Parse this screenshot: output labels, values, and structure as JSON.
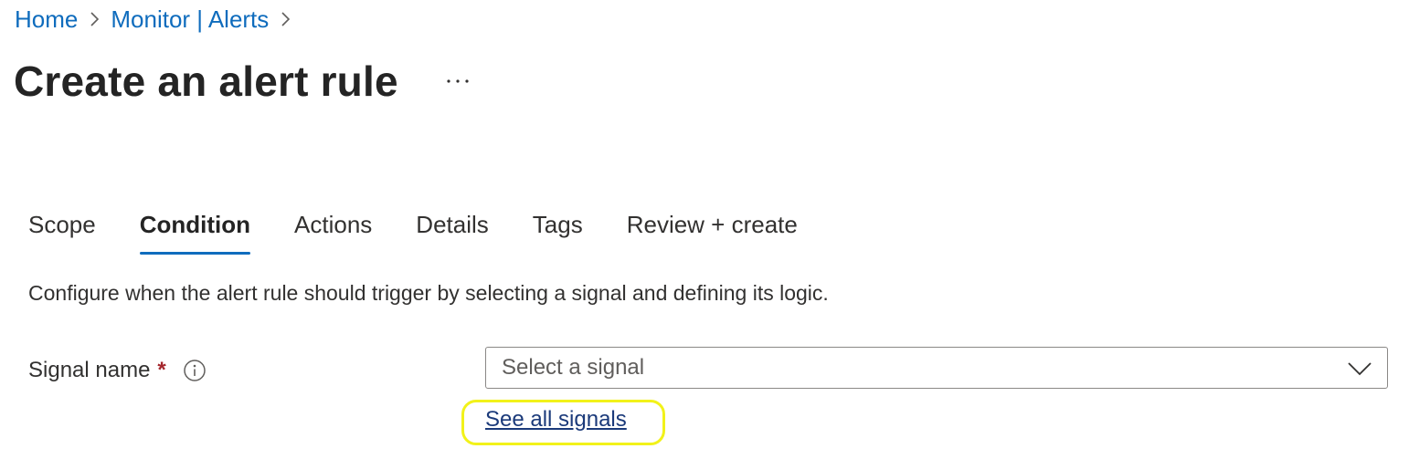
{
  "breadcrumb": {
    "items": [
      "Home",
      "Monitor | Alerts"
    ]
  },
  "header": {
    "title": "Create an alert rule",
    "more_label": "···"
  },
  "tabs": [
    {
      "label": "Scope",
      "active": false
    },
    {
      "label": "Condition",
      "active": true
    },
    {
      "label": "Actions",
      "active": false
    },
    {
      "label": "Details",
      "active": false
    },
    {
      "label": "Tags",
      "active": false
    },
    {
      "label": "Review + create",
      "active": false
    }
  ],
  "condition": {
    "description": "Configure when the alert rule should trigger by selecting a signal and defining its logic.",
    "signal_label": "Signal name",
    "required_marker": "*",
    "signal_placeholder": "Select a signal",
    "see_all_link": "See all signals"
  },
  "colors": {
    "link": "#0f6cbd",
    "active_tab_underline": "#0f6cbd",
    "required": "#a4262c",
    "highlight": "#f2f21a"
  },
  "icons": {
    "breadcrumb_separator": "chevron-right-icon",
    "more": "ellipsis-icon",
    "info": "info-icon",
    "dropdown": "chevron-down-icon"
  }
}
